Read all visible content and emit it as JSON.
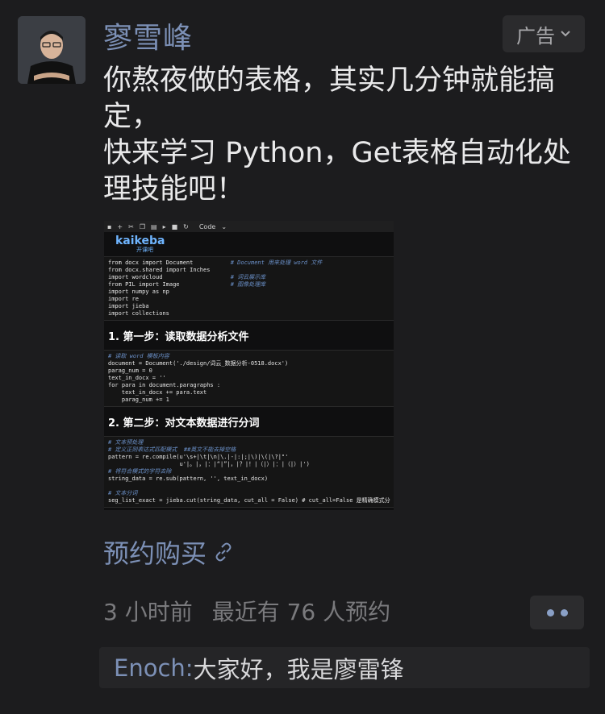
{
  "post": {
    "author": "寥雪峰",
    "ad_label": "广告",
    "ad_icon": "chevron-down-icon",
    "text_lines": [
      "你熬夜做的表格，其实几分钟就能搞定，",
      "快来学习 Python，Get表格自动化处理技能吧！"
    ],
    "cta_label": "预约购买",
    "cta_icon": "link-icon",
    "time_ago": "3 小时前",
    "reservations": "最近有 76 人预约",
    "more_icon": "more-dots-icon"
  },
  "screenshot": {
    "toolbar_mode": "Code",
    "brand_name": "kaikeba",
    "brand_sub": "开课吧",
    "code_block_1": [
      [
        "from docx import Document",
        "# Document 用来处理 word 文件"
      ],
      [
        "from docx.shared import Inches",
        ""
      ],
      [
        "import wordcloud",
        "# 词云展示库"
      ],
      [
        "from PIL import Image",
        "# 图像处理库"
      ],
      [
        "import numpy as np",
        ""
      ],
      [
        "import re",
        ""
      ],
      [
        "import jieba",
        ""
      ],
      [
        "import collections",
        ""
      ]
    ],
    "step_1": "1. 第一步：读取数据分析文件",
    "code_block_2": [
      "# 读取 word 模板内容",
      "document = Document('./design/词云_数据分析-0518.docx')",
      "parag_num = 0",
      "text_in_docx = ''",
      "for para in document.paragraphs :",
      "    text_in_docx += para.text",
      "    parag_num += 1"
    ],
    "step_2": "2. 第二步：对文本数据进行分词",
    "code_block_3": [
      "# 文本预处理",
      "# 定义正则表达式匹配模式  ##英文不能去掉空格",
      "pattern = re.compile(u'\\s+|\\t|\\n|\\.|-|:|;|\\)|\\(|\\?|\"'",
      "                     u'|。|，|：|“|”|，|？|！|（|）|：|（|）|')",
      "# 将符合模式的字符去除",
      "string_data = re.sub(pattern, '', text_in_docx)",
      "",
      "# 文本分词",
      "seg_list_exact = jieba.cut(string_data, cut_all = False) # cut_all=False 是精确模式分"
    ]
  },
  "comment": {
    "name": "Enoch",
    "separator": ": ",
    "text": "大家好，我是廖雷锋"
  }
}
